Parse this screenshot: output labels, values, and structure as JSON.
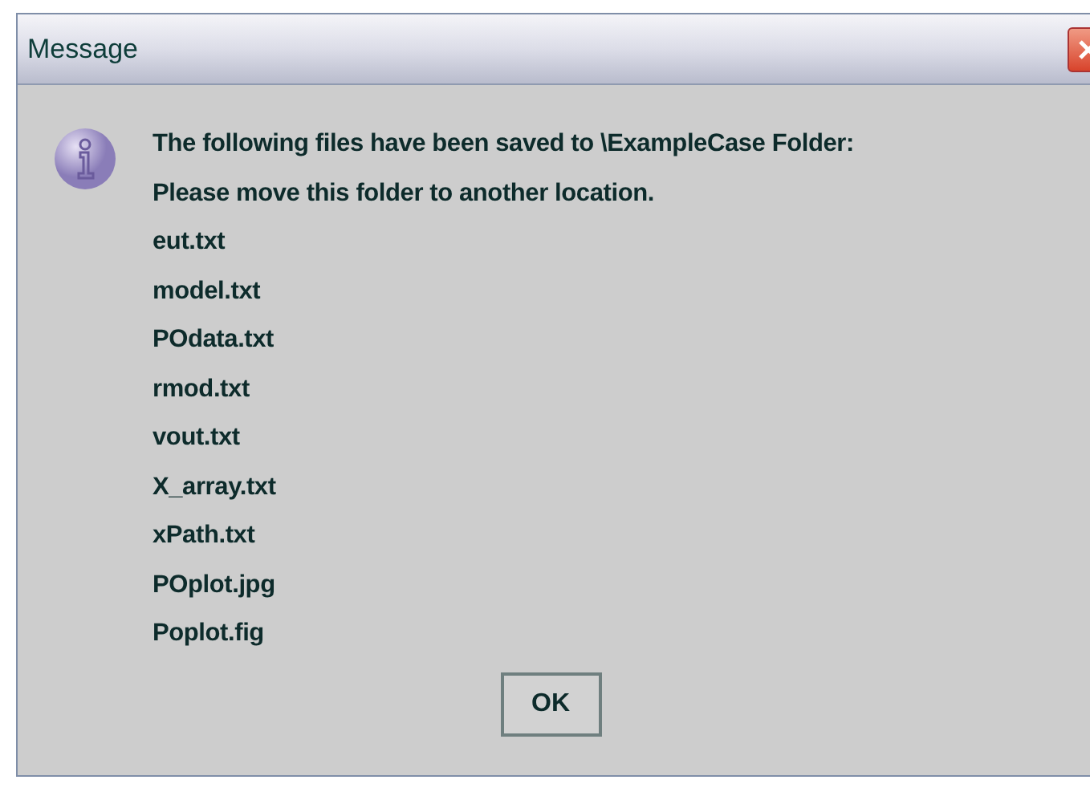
{
  "window": {
    "title": "Message"
  },
  "message": {
    "lines": [
      "The following files have been saved to \\ExampleCase Folder:",
      "Please move this folder to another location."
    ],
    "files": [
      "eut.txt",
      "model.txt",
      "POdata.txt",
      "rmod.txt",
      "vout.txt",
      "X_array.txt",
      "xPath.txt",
      "POplot.jpg",
      "Poplot.fig"
    ]
  },
  "buttons": [
    "OK"
  ]
}
